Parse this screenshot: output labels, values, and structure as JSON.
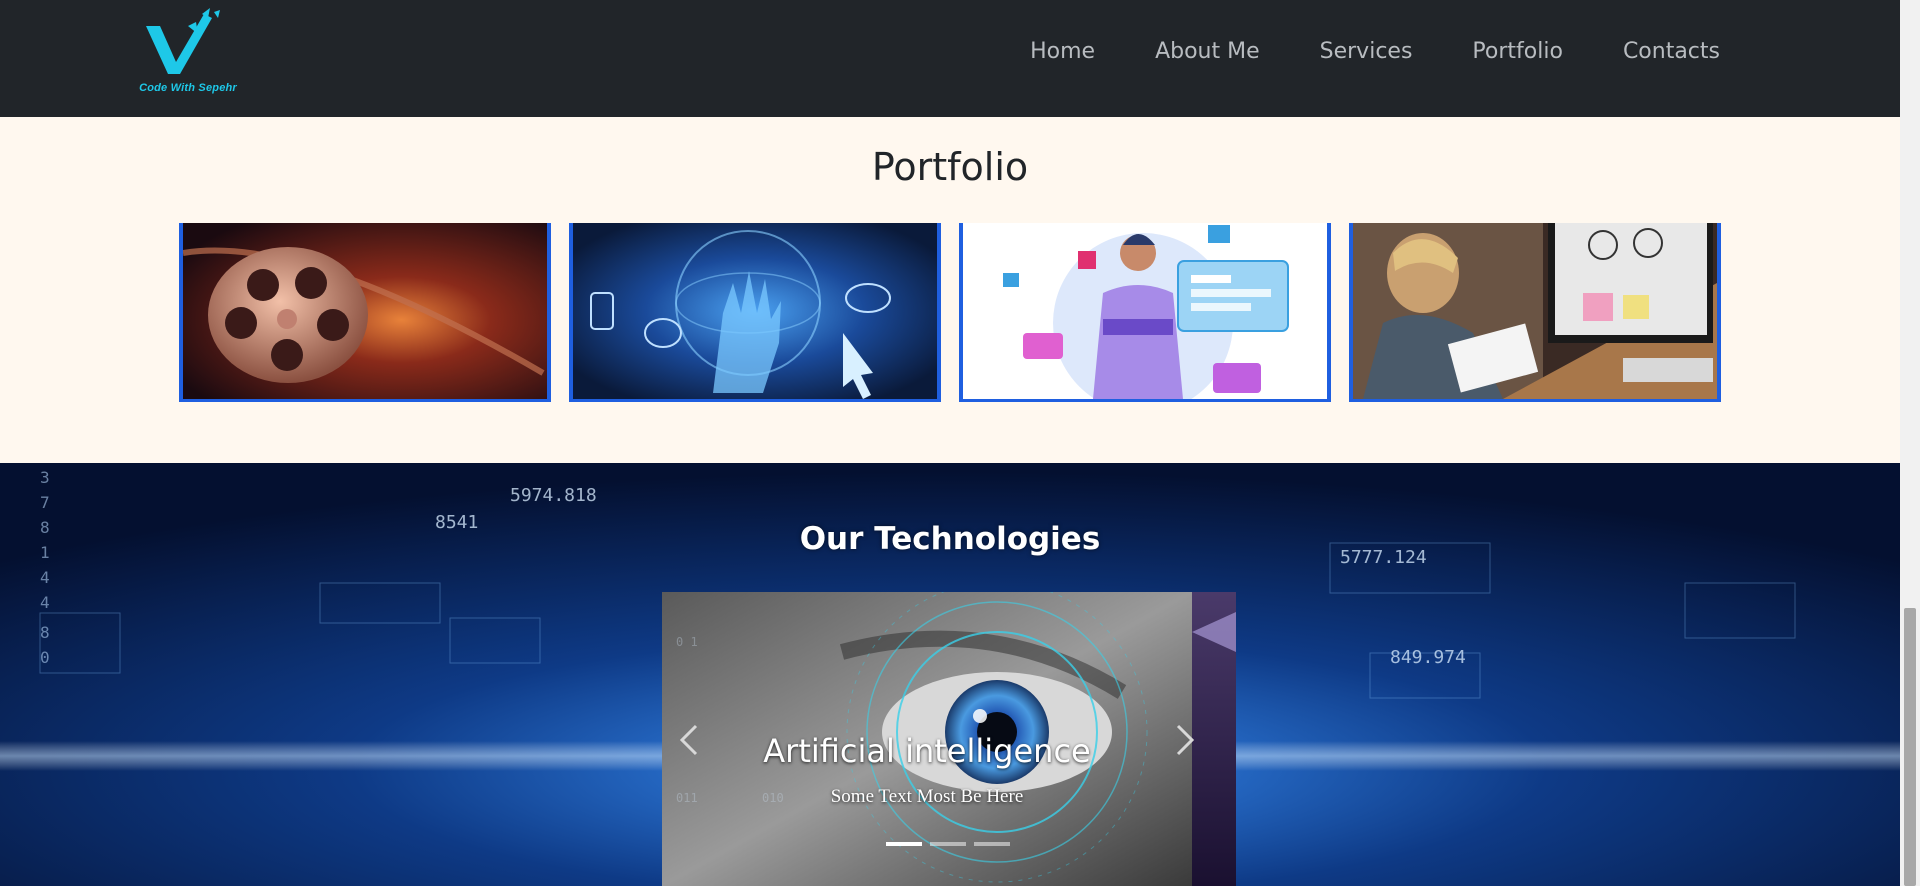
{
  "brand": {
    "logo_text": "Code With Sepehr",
    "accent": "#1ec8e8"
  },
  "nav": {
    "items": [
      {
        "label": "Home"
      },
      {
        "label": "About Me"
      },
      {
        "label": "Services"
      },
      {
        "label": "Portfolio"
      },
      {
        "label": "Contacts"
      }
    ]
  },
  "portfolio": {
    "title": "Portfolio",
    "cards": [
      {
        "icon": "film-reel-image"
      },
      {
        "icon": "digital-hand-image"
      },
      {
        "icon": "designer-illustration-image"
      },
      {
        "icon": "graphic-designer-desk-image"
      }
    ]
  },
  "technologies": {
    "title": "Our Technologies",
    "slide": {
      "title": "Artificial intelligence",
      "text": "Some Text Most Be Here",
      "icon": "eye-scan-image"
    },
    "slide_count": 3,
    "active_index": 0
  },
  "colors": {
    "navbar": "#212529",
    "portfolio_bg": "#fff8ef",
    "card_border": "#1f5fe0"
  }
}
